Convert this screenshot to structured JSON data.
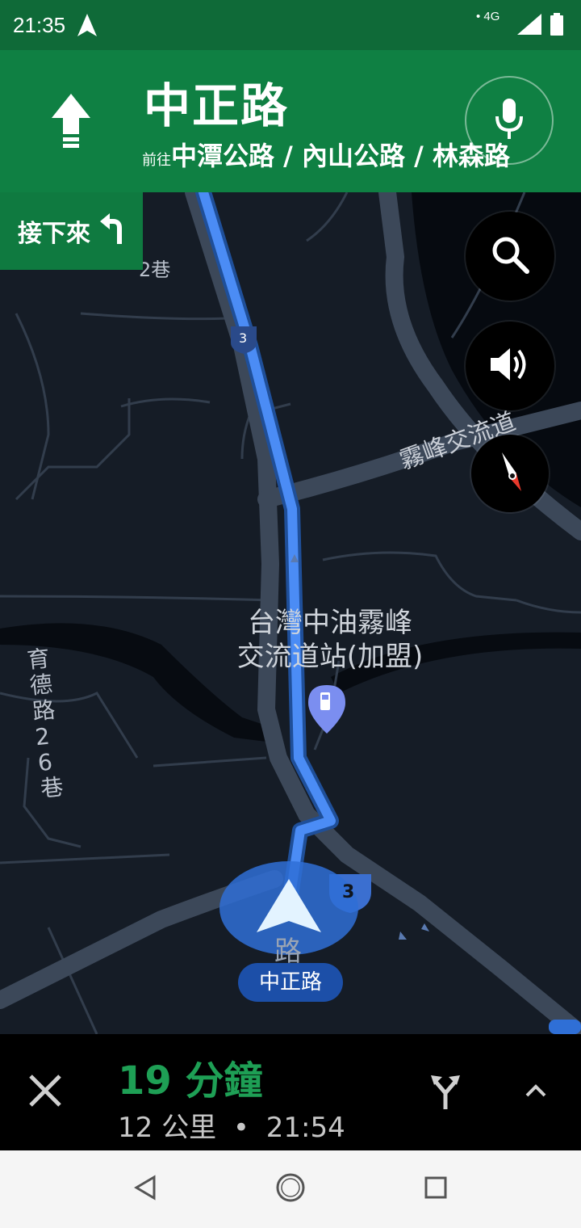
{
  "status_bar": {
    "time": "21:35",
    "network": "4G"
  },
  "header": {
    "street": "中正路",
    "toward_prefix": "前往",
    "toward_roads": "中潭公路 / 內山公路 / 林森路",
    "maneuver_icon": "straight-arrow-icon",
    "mic_icon": "mic-icon"
  },
  "next_step": {
    "label": "接下來",
    "icon": "turn-left-icon"
  },
  "map": {
    "labels": {
      "lane_suffix": "2巷",
      "interchange": "霧峰交流道",
      "poi_line1": "台灣中油霧峰",
      "poi_line2": "交流道站(加盟)",
      "side_road": "育德路26巷",
      "road_fragment": "路"
    },
    "shield_number": "3",
    "current_road_chip": "中正路",
    "controls": [
      "search-icon",
      "sound-icon",
      "compass-icon"
    ],
    "colors": {
      "route": "#4b8cf5",
      "header": "#0f8043",
      "eta": "#1e9f55"
    }
  },
  "trip": {
    "duration": "19 分鐘",
    "distance": "12 公里",
    "separator": "•",
    "arrival": "21:54"
  },
  "system_nav": [
    "back",
    "home",
    "recents"
  ]
}
